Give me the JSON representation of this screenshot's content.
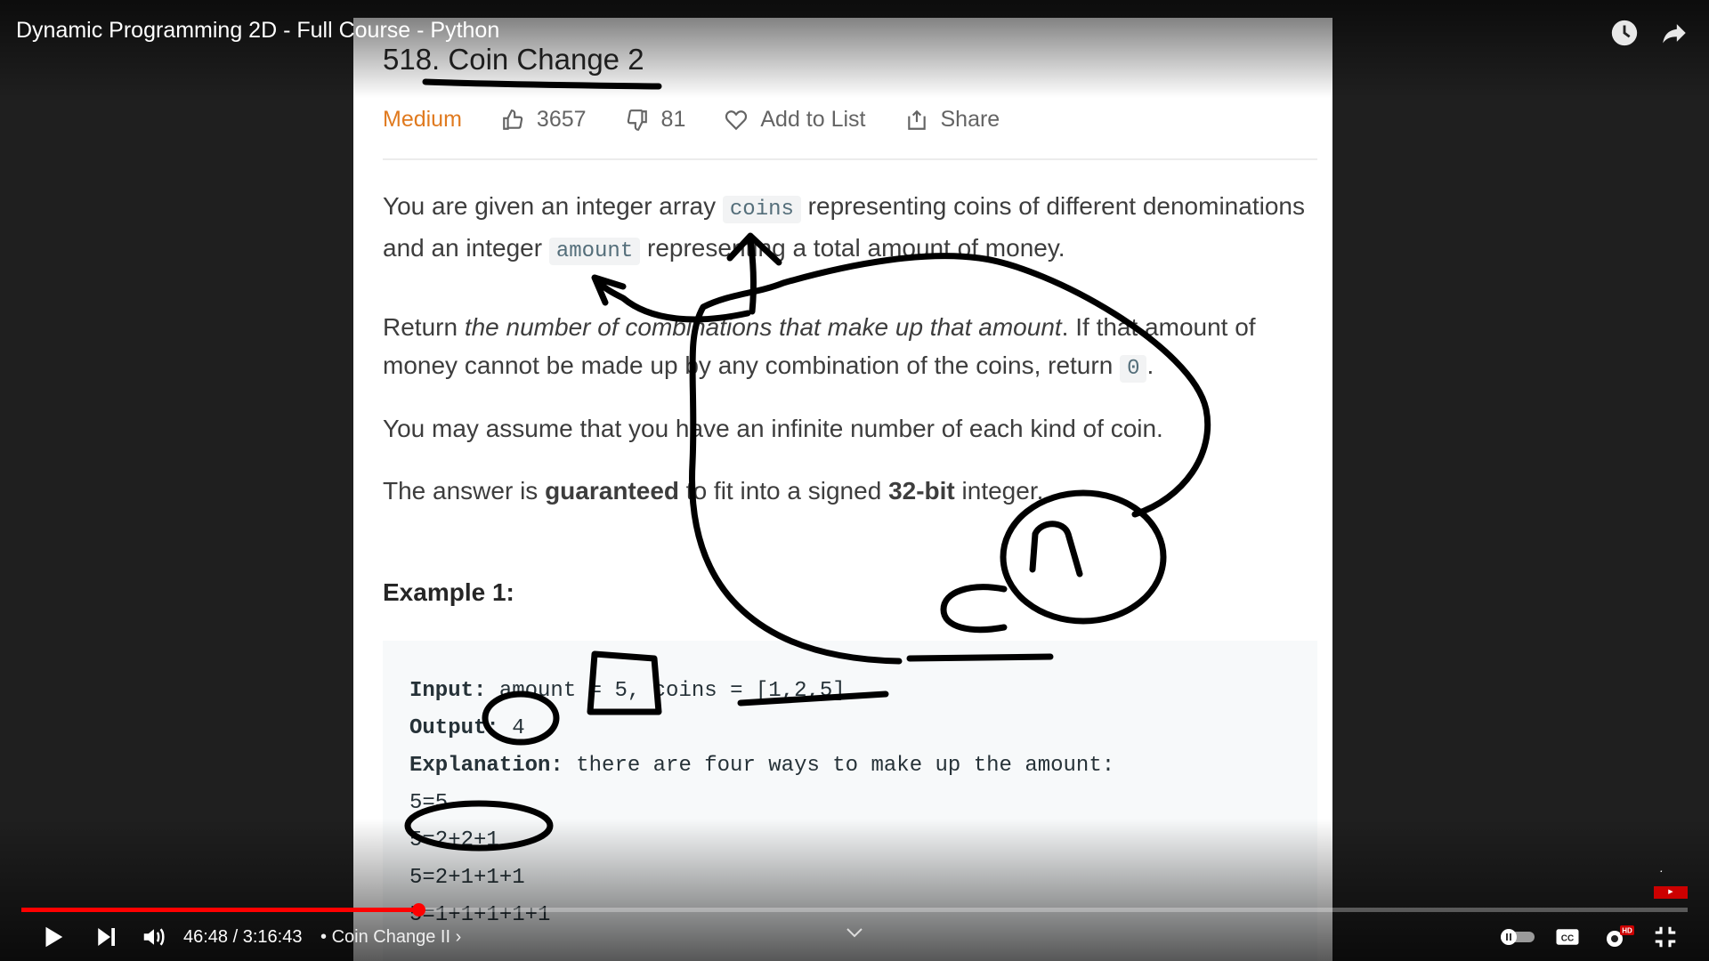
{
  "video": {
    "title": "Dynamic Programming 2D - Full Course - Python",
    "current_time": "46:48",
    "duration": "3:16:43",
    "time_separator": " / ",
    "chapter": "Coin Change II",
    "chapter_prefix": "•",
    "chapter_arrow": "›",
    "progress_fraction": 0.238
  },
  "problem": {
    "title": "518. Coin Change 2",
    "difficulty": "Medium",
    "likes": "3657",
    "dislikes": "81",
    "add_to_list": "Add to List",
    "share": "Share",
    "p1_a": "You are given an integer array ",
    "p1_code1": "coins",
    "p1_b": " representing coins of different denominations and an integer ",
    "p1_code2": "amount",
    "p1_c": " representing a total amount of money.",
    "p2_a": "Return ",
    "p2_em": "the number of combinations that make up that amount",
    "p2_b": ". If that amount of money cannot be made up by any combination of the coins, return ",
    "p2_code": "0",
    "p2_c": ".",
    "p3": "You may assume that you have an infinite number of each kind of coin.",
    "p4_a": "The answer is ",
    "p4_b1": "guaranteed",
    "p4_b": " to fit into a signed ",
    "p4_b2": "32-bit",
    "p4_c": " integer.",
    "example_title": "Example 1:",
    "example": {
      "input_label": "Input:",
      "input_value": " amount = 5, coins = [1,2,5]",
      "output_label": "Output:",
      "output_value": " 4",
      "explanation_label": "Explanation:",
      "explanation_value": " there are four ways to make up the amount:",
      "ways": [
        "5=5",
        "5=2+2+1",
        "5=2+1+1+1",
        "5=1+1+1+1+1"
      ]
    }
  },
  "colors": {
    "accent": "#ff0000",
    "difficulty": "#e07a1f",
    "ink": "#000000"
  }
}
